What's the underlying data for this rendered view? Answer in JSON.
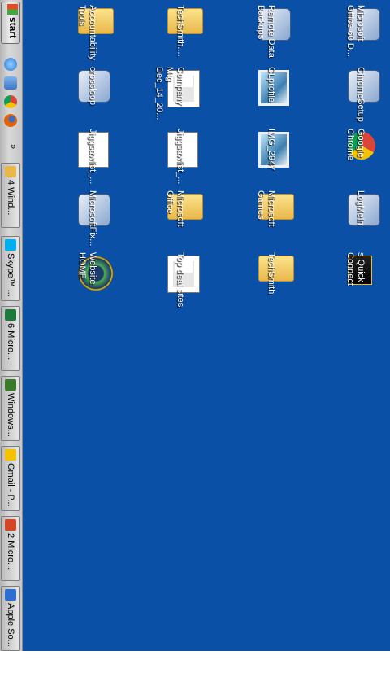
{
  "taskbar": {
    "start_label": "start",
    "quick_launch": [
      {
        "name": "internet-explorer",
        "color": "#2c76d6"
      },
      {
        "name": "desktop",
        "color": "#3a78c9"
      },
      {
        "name": "chrome",
        "color": "#f4c200"
      },
      {
        "name": "firefox",
        "color": "#e66000"
      }
    ],
    "overflow_label": "»",
    "buttons": [
      {
        "label": "4 Wind...",
        "icon": "folder-icon",
        "color": "#e9b84a"
      },
      {
        "label": "Skype™ ...",
        "icon": "skype-icon",
        "color": "#00aff0"
      },
      {
        "label": "6 Micro...",
        "icon": "excel-icon",
        "color": "#1d7a3c"
      },
      {
        "label": "Windows...",
        "icon": "windows-icon",
        "color": "#3b7a2a"
      },
      {
        "label": "Gmail - P...",
        "icon": "chrome-icon",
        "color": "#f4c200"
      },
      {
        "label": "2 Micro...",
        "icon": "powerpoint-icon",
        "color": "#d24726"
      },
      {
        "label": "Apple So...",
        "icon": "apple-update-icon",
        "color": "#2d6fd0"
      }
    ]
  },
  "desktop": {
    "background": "#0a50a6",
    "icons": [
      {
        "label": "Microsoft Office 60 D...",
        "icon": "office-install-icon"
      },
      {
        "label": "ChromeSetup",
        "icon": "installer-icon"
      },
      {
        "label": "Google Chrome",
        "icon": "chrome-icon"
      },
      {
        "label": "LogMeIn",
        "icon": "installer-icon"
      },
      {
        "label": "s Quick Connect",
        "icon": "app-icon"
      },
      {
        "label": "Remote Data Backups",
        "icon": "backup-icon"
      },
      {
        "label": "CLprofile",
        "icon": "picture-icon"
      },
      {
        "label": "IMG_2947",
        "icon": "picture-icon"
      },
      {
        "label": "Microsoft Games",
        "icon": "folder-icon"
      },
      {
        "label": "TechSmith",
        "icon": "folder-icon"
      },
      {
        "label": "TechSmith....",
        "icon": "folder-icon"
      },
      {
        "label": "Company Mtg Dec_14_20...",
        "icon": "powerpoint-doc-icon"
      },
      {
        "label": "Jiggsawlist_...",
        "icon": "excel-doc-icon"
      },
      {
        "label": "Microsoft Office",
        "icon": "folder-icon"
      },
      {
        "label": "Top deal sites",
        "icon": "powerpoint-doc-icon"
      },
      {
        "label": "Accountability Tools",
        "icon": "folder-icon"
      },
      {
        "label": "crossloop",
        "icon": "crossloop-icon"
      },
      {
        "label": "Jiggsawlist_...",
        "icon": "excel-doc-icon"
      },
      {
        "label": "MicrosoftFix...",
        "icon": "fixit-icon"
      },
      {
        "label": "Website HOME",
        "icon": "globe-icon"
      }
    ]
  }
}
